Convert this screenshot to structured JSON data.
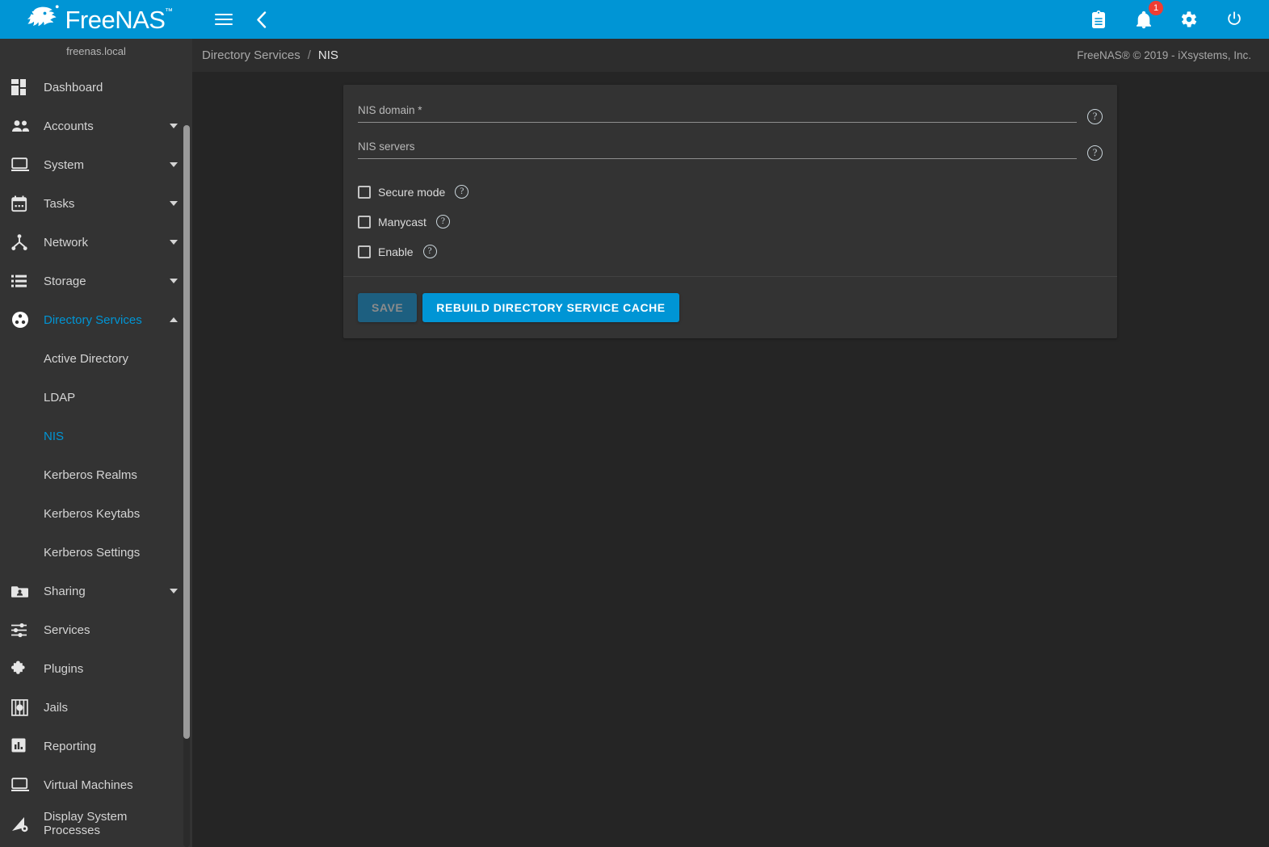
{
  "theme": {
    "accent": "#0095d5",
    "sidebar_bg": "#333333",
    "page_bg": "#252525",
    "card_bg": "#333333",
    "badge_color": "#ef3d32"
  },
  "topbar": {
    "logo_text": "FreeNAS",
    "logo_tm": "™",
    "menu_icon": "hamburger-menu-icon",
    "back_icon": "chevron-left-icon",
    "right_icons": [
      {
        "name": "clipboard-icon",
        "label": "Tasks"
      },
      {
        "name": "notifications-bell-icon",
        "label": "Alerts",
        "badge": "1"
      },
      {
        "name": "gear-icon",
        "label": "Settings"
      },
      {
        "name": "power-icon",
        "label": "Power"
      }
    ]
  },
  "sidebar": {
    "hostname": "freenas.local",
    "items": [
      {
        "label": "Dashboard",
        "icon": "dashboard-grid-icon",
        "expandable": false
      },
      {
        "label": "Accounts",
        "icon": "users-icon",
        "expandable": true,
        "expanded": false
      },
      {
        "label": "System",
        "icon": "monitor-icon",
        "expandable": true,
        "expanded": false
      },
      {
        "label": "Tasks",
        "icon": "calendar-icon",
        "expandable": true,
        "expanded": false
      },
      {
        "label": "Network",
        "icon": "network-node-icon",
        "expandable": true,
        "expanded": false
      },
      {
        "label": "Storage",
        "icon": "storage-list-icon",
        "expandable": true,
        "expanded": false
      },
      {
        "label": "Directory Services",
        "icon": "directory-services-icon",
        "expandable": true,
        "expanded": true,
        "active": true
      },
      {
        "label": "Sharing",
        "icon": "folder-share-icon",
        "expandable": true,
        "expanded": false
      },
      {
        "label": "Services",
        "icon": "sliders-icon",
        "expandable": false
      },
      {
        "label": "Plugins",
        "icon": "puzzle-piece-icon",
        "expandable": false
      },
      {
        "label": "Jails",
        "icon": "jail-cell-icon",
        "expandable": false
      },
      {
        "label": "Reporting",
        "icon": "bar-chart-icon",
        "expandable": false
      },
      {
        "label": "Virtual Machines",
        "icon": "monitor-icon",
        "expandable": false
      },
      {
        "label": "Display System Processes",
        "icon": "processes-icon",
        "expandable": false
      }
    ],
    "directory_services_children": [
      {
        "label": "Active Directory",
        "active": false
      },
      {
        "label": "LDAP",
        "active": false
      },
      {
        "label": "NIS",
        "active": true
      },
      {
        "label": "Kerberos Realms",
        "active": false
      },
      {
        "label": "Kerberos Keytabs",
        "active": false
      },
      {
        "label": "Kerberos Settings",
        "active": false
      }
    ]
  },
  "breadcrumb": {
    "parent": "Directory Services",
    "separator": "/",
    "current": "NIS"
  },
  "footer": {
    "copyright": "FreeNAS® © 2019 - iXsystems, Inc."
  },
  "form": {
    "fields": [
      {
        "label": "NIS domain *",
        "value": "",
        "placeholder": "",
        "help_icon": "help-circle-icon"
      },
      {
        "label": "NIS servers",
        "value": "",
        "placeholder": "",
        "help_icon": "help-circle-icon"
      }
    ],
    "checkboxes": [
      {
        "label": "Secure mode",
        "checked": false,
        "help_icon": "help-circle-icon"
      },
      {
        "label": "Manycast",
        "checked": false,
        "help_icon": "help-circle-icon"
      },
      {
        "label": "Enable",
        "checked": false,
        "help_icon": "help-circle-icon"
      }
    ],
    "buttons": {
      "save": {
        "label": "SAVE",
        "disabled": true
      },
      "rebuild": {
        "label": "REBUILD DIRECTORY SERVICE CACHE",
        "disabled": false
      }
    },
    "help_glyph": "?"
  }
}
